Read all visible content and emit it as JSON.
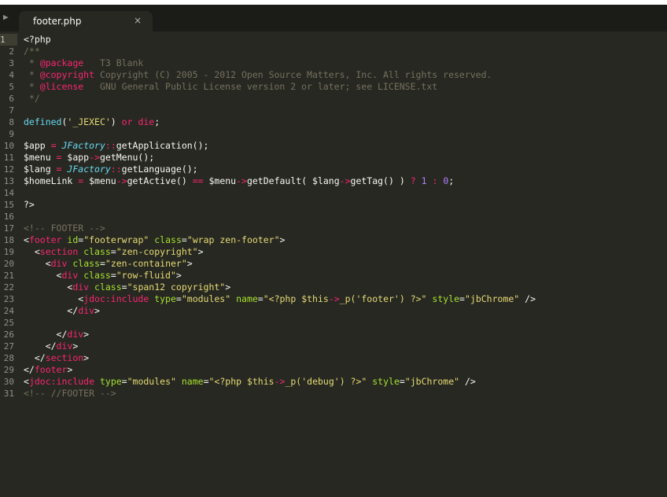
{
  "tab": {
    "filename": "footer.php",
    "close_glyph": "×"
  },
  "sidebar_toggle": "▶",
  "active_line": 1,
  "lines": [
    {
      "n": "1",
      "tokens": [
        {
          "t": "<?php",
          "c": ""
        }
      ]
    },
    {
      "n": "2",
      "tokens": [
        {
          "t": "/**",
          "c": "t-cmt"
        }
      ]
    },
    {
      "n": "3",
      "tokens": [
        {
          "t": " * ",
          "c": "t-cmt"
        },
        {
          "t": "@package",
          "c": "t-doc"
        },
        {
          "t": "   T3 Blank",
          "c": "t-cmt"
        }
      ]
    },
    {
      "n": "4",
      "tokens": [
        {
          "t": " * ",
          "c": "t-cmt"
        },
        {
          "t": "@copyright",
          "c": "t-doc"
        },
        {
          "t": " Copyright (C) 2005 - 2012 Open Source Matters, Inc. All rights reserved.",
          "c": "t-cmt"
        }
      ]
    },
    {
      "n": "5",
      "tokens": [
        {
          "t": " * ",
          "c": "t-cmt"
        },
        {
          "t": "@license",
          "c": "t-doc"
        },
        {
          "t": "   GNU General Public License version 2 or later; see LICENSE.txt",
          "c": "t-cmt"
        }
      ]
    },
    {
      "n": "6",
      "tokens": [
        {
          "t": " */",
          "c": "t-cmt"
        }
      ]
    },
    {
      "n": "7",
      "tokens": []
    },
    {
      "n": "8",
      "tokens": [
        {
          "t": "defined",
          "c": "t-fn"
        },
        {
          "t": "(",
          "c": ""
        },
        {
          "t": "'_JEXEC'",
          "c": "t-str"
        },
        {
          "t": ") ",
          "c": ""
        },
        {
          "t": "or",
          "c": "t-kw"
        },
        {
          "t": " ",
          "c": ""
        },
        {
          "t": "die",
          "c": "t-kw"
        },
        {
          "t": ";",
          "c": ""
        }
      ]
    },
    {
      "n": "9",
      "tokens": []
    },
    {
      "n": "10",
      "tokens": [
        {
          "t": "$app ",
          "c": ""
        },
        {
          "t": "=",
          "c": "t-kw"
        },
        {
          "t": " ",
          "c": ""
        },
        {
          "t": "JFactory",
          "c": "t-cls"
        },
        {
          "t": "::",
          "c": "t-kw"
        },
        {
          "t": "getApplication();",
          "c": ""
        }
      ]
    },
    {
      "n": "11",
      "tokens": [
        {
          "t": "$menu ",
          "c": ""
        },
        {
          "t": "=",
          "c": "t-kw"
        },
        {
          "t": " $app",
          "c": ""
        },
        {
          "t": "->",
          "c": "t-kw"
        },
        {
          "t": "getMenu();",
          "c": ""
        }
      ]
    },
    {
      "n": "12",
      "tokens": [
        {
          "t": "$lang ",
          "c": ""
        },
        {
          "t": "=",
          "c": "t-kw"
        },
        {
          "t": " ",
          "c": ""
        },
        {
          "t": "JFactory",
          "c": "t-cls"
        },
        {
          "t": "::",
          "c": "t-kw"
        },
        {
          "t": "getLanguage();",
          "c": ""
        }
      ]
    },
    {
      "n": "13",
      "tokens": [
        {
          "t": "$homeLink ",
          "c": ""
        },
        {
          "t": "=",
          "c": "t-kw"
        },
        {
          "t": " $menu",
          "c": ""
        },
        {
          "t": "->",
          "c": "t-kw"
        },
        {
          "t": "getActive() ",
          "c": ""
        },
        {
          "t": "==",
          "c": "t-kw"
        },
        {
          "t": " $menu",
          "c": ""
        },
        {
          "t": "->",
          "c": "t-kw"
        },
        {
          "t": "getDefault( $lang",
          "c": ""
        },
        {
          "t": "->",
          "c": "t-kw"
        },
        {
          "t": "getTag() ) ",
          "c": ""
        },
        {
          "t": "?",
          "c": "t-kw"
        },
        {
          "t": " ",
          "c": ""
        },
        {
          "t": "1",
          "c": "t-num"
        },
        {
          "t": " ",
          "c": ""
        },
        {
          "t": ":",
          "c": "t-kw"
        },
        {
          "t": " ",
          "c": ""
        },
        {
          "t": "0",
          "c": "t-num"
        },
        {
          "t": ";",
          "c": ""
        }
      ]
    },
    {
      "n": "14",
      "tokens": []
    },
    {
      "n": "15",
      "tokens": [
        {
          "t": "?>",
          "c": ""
        }
      ]
    },
    {
      "n": "16",
      "tokens": []
    },
    {
      "n": "17",
      "tokens": [
        {
          "t": "<!-- FOOTER -->",
          "c": "t-cmt"
        }
      ]
    },
    {
      "n": "18",
      "tokens": [
        {
          "t": "<",
          "c": ""
        },
        {
          "t": "footer",
          "c": "t-tag"
        },
        {
          "t": " ",
          "c": ""
        },
        {
          "t": "id",
          "c": "t-attr"
        },
        {
          "t": "=",
          "c": ""
        },
        {
          "t": "\"footerwrap\"",
          "c": "t-str"
        },
        {
          "t": " ",
          "c": ""
        },
        {
          "t": "class",
          "c": "t-attr"
        },
        {
          "t": "=",
          "c": ""
        },
        {
          "t": "\"wrap zen-footer\"",
          "c": "t-str"
        },
        {
          "t": ">",
          "c": ""
        }
      ]
    },
    {
      "n": "19",
      "tokens": [
        {
          "t": "  <",
          "c": ""
        },
        {
          "t": "section",
          "c": "t-tag"
        },
        {
          "t": " ",
          "c": ""
        },
        {
          "t": "class",
          "c": "t-attr"
        },
        {
          "t": "=",
          "c": ""
        },
        {
          "t": "\"zen-copyright\"",
          "c": "t-str"
        },
        {
          "t": ">",
          "c": ""
        }
      ]
    },
    {
      "n": "20",
      "tokens": [
        {
          "t": "    <",
          "c": ""
        },
        {
          "t": "div",
          "c": "t-tag"
        },
        {
          "t": " ",
          "c": ""
        },
        {
          "t": "class",
          "c": "t-attr"
        },
        {
          "t": "=",
          "c": ""
        },
        {
          "t": "\"zen-container\"",
          "c": "t-str"
        },
        {
          "t": ">",
          "c": ""
        }
      ]
    },
    {
      "n": "21",
      "tokens": [
        {
          "t": "      <",
          "c": ""
        },
        {
          "t": "div",
          "c": "t-tag"
        },
        {
          "t": " ",
          "c": ""
        },
        {
          "t": "class",
          "c": "t-attr"
        },
        {
          "t": "=",
          "c": ""
        },
        {
          "t": "\"row-fluid\"",
          "c": "t-str"
        },
        {
          "t": ">",
          "c": ""
        }
      ]
    },
    {
      "n": "22",
      "tokens": [
        {
          "t": "        <",
          "c": ""
        },
        {
          "t": "div",
          "c": "t-tag"
        },
        {
          "t": " ",
          "c": ""
        },
        {
          "t": "class",
          "c": "t-attr"
        },
        {
          "t": "=",
          "c": ""
        },
        {
          "t": "\"span12 copyright\"",
          "c": "t-str"
        },
        {
          "t": ">",
          "c": ""
        }
      ]
    },
    {
      "n": "23",
      "tokens": [
        {
          "t": "          <",
          "c": ""
        },
        {
          "t": "jdoc:include",
          "c": "t-tag"
        },
        {
          "t": " ",
          "c": ""
        },
        {
          "t": "type",
          "c": "t-attr"
        },
        {
          "t": "=",
          "c": ""
        },
        {
          "t": "\"modules\"",
          "c": "t-str"
        },
        {
          "t": " ",
          "c": ""
        },
        {
          "t": "name",
          "c": "t-attr"
        },
        {
          "t": "=",
          "c": ""
        },
        {
          "t": "\"<?php $this",
          "c": "t-str"
        },
        {
          "t": "->",
          "c": "t-kw"
        },
        {
          "t": "_p('footer') ?>\"",
          "c": "t-str"
        },
        {
          "t": " ",
          "c": ""
        },
        {
          "t": "style",
          "c": "t-attr"
        },
        {
          "t": "=",
          "c": ""
        },
        {
          "t": "\"jbChrome\"",
          "c": "t-str"
        },
        {
          "t": " />",
          "c": ""
        }
      ]
    },
    {
      "n": "24",
      "tokens": [
        {
          "t": "        </",
          "c": ""
        },
        {
          "t": "div",
          "c": "t-tag"
        },
        {
          "t": ">",
          "c": ""
        }
      ]
    },
    {
      "n": "25",
      "tokens": []
    },
    {
      "n": "26",
      "tokens": [
        {
          "t": "      </",
          "c": ""
        },
        {
          "t": "div",
          "c": "t-tag"
        },
        {
          "t": ">",
          "c": ""
        }
      ]
    },
    {
      "n": "27",
      "tokens": [
        {
          "t": "    </",
          "c": ""
        },
        {
          "t": "div",
          "c": "t-tag"
        },
        {
          "t": ">",
          "c": ""
        }
      ]
    },
    {
      "n": "28",
      "tokens": [
        {
          "t": "  </",
          "c": ""
        },
        {
          "t": "section",
          "c": "t-tag"
        },
        {
          "t": ">",
          "c": ""
        }
      ]
    },
    {
      "n": "29",
      "tokens": [
        {
          "t": "</",
          "c": ""
        },
        {
          "t": "footer",
          "c": "t-tag"
        },
        {
          "t": ">",
          "c": ""
        }
      ]
    },
    {
      "n": "30",
      "tokens": [
        {
          "t": "<",
          "c": ""
        },
        {
          "t": "jdoc:include",
          "c": "t-tag"
        },
        {
          "t": " ",
          "c": ""
        },
        {
          "t": "type",
          "c": "t-attr"
        },
        {
          "t": "=",
          "c": ""
        },
        {
          "t": "\"modules\"",
          "c": "t-str"
        },
        {
          "t": " ",
          "c": ""
        },
        {
          "t": "name",
          "c": "t-attr"
        },
        {
          "t": "=",
          "c": ""
        },
        {
          "t": "\"<?php $this",
          "c": "t-str"
        },
        {
          "t": "->",
          "c": "t-kw"
        },
        {
          "t": "_p('debug') ?>\"",
          "c": "t-str"
        },
        {
          "t": " ",
          "c": ""
        },
        {
          "t": "style",
          "c": "t-attr"
        },
        {
          "t": "=",
          "c": ""
        },
        {
          "t": "\"jbChrome\"",
          "c": "t-str"
        },
        {
          "t": " />",
          "c": ""
        }
      ]
    },
    {
      "n": "31",
      "tokens": [
        {
          "t": "<!-- //FOOTER -->",
          "c": "t-cmt"
        }
      ]
    }
  ]
}
